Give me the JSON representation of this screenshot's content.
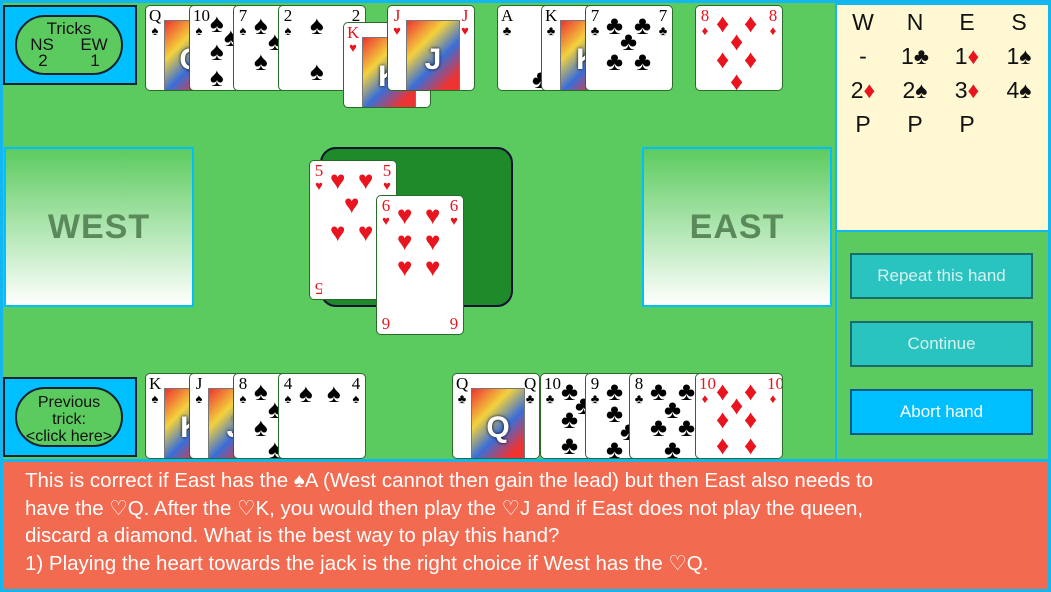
{
  "tricks": {
    "title": "Tricks",
    "ns_label": "NS",
    "ew_label": "EW",
    "ns": "2",
    "ew": "1"
  },
  "previous_trick": {
    "line1": "Previous",
    "line2": "trick:",
    "line3": "<click here>"
  },
  "west_label": "WEST",
  "east_label": "EAST",
  "bidding": {
    "headers": [
      "W",
      "N",
      "E",
      "S"
    ],
    "rows": [
      [
        "-",
        "1♣",
        "1♦",
        "1♠"
      ],
      [
        "2♦",
        "2♠",
        "3♦",
        "4♠"
      ],
      [
        "P",
        "P",
        "P",
        ""
      ]
    ]
  },
  "buttons": {
    "repeat": "Repeat this hand",
    "continue": "Continue",
    "abort": "Abort hand"
  },
  "north_hand": [
    {
      "rank": "Q",
      "suit": "♠",
      "face": true
    },
    {
      "rank": "10",
      "suit": "♠"
    },
    {
      "rank": "7",
      "suit": "♠"
    },
    {
      "rank": "2",
      "suit": "♠"
    },
    {
      "rank": "K",
      "suit": "♥",
      "face": true
    },
    {
      "rank": "J",
      "suit": "♥",
      "face": true
    },
    {
      "rank": "A",
      "suit": "♣"
    },
    {
      "rank": "K",
      "suit": "♣",
      "face": true
    },
    {
      "rank": "7",
      "suit": "♣"
    },
    {
      "rank": "8",
      "suit": "♦"
    }
  ],
  "south_hand": [
    {
      "rank": "K",
      "suit": "♠",
      "face": true
    },
    {
      "rank": "J",
      "suit": "♠",
      "face": true
    },
    {
      "rank": "8",
      "suit": "♠"
    },
    {
      "rank": "4",
      "suit": "♠"
    },
    {
      "rank": "Q",
      "suit": "♣",
      "face": true
    },
    {
      "rank": "10",
      "suit": "♣"
    },
    {
      "rank": "9",
      "suit": "♣"
    },
    {
      "rank": "8",
      "suit": "♣"
    },
    {
      "rank": "10",
      "suit": "♦"
    }
  ],
  "trick_cards": [
    {
      "rank": "5",
      "suit": "♥"
    },
    {
      "rank": "6",
      "suit": "♥"
    }
  ],
  "message": {
    "lines": [
      "This is correct if East has the ♠A (West cannot then gain the lead) but then East also needs to",
      "have the ♡Q. After the ♡K, you would then play the ♡J and if East does not play the queen,",
      "discard a diamond. What is the best way to play this hand?",
      "1) Playing the heart towards the jack is the right choice if West has the ♡Q."
    ]
  },
  "colors": {
    "felt": "#5ccb5f",
    "frame": "#14b6f0",
    "message_bg": "#f26a50",
    "trick_area": "#1f8a2a",
    "button": "#2ac4c0",
    "abort_button": "#00bfff"
  }
}
